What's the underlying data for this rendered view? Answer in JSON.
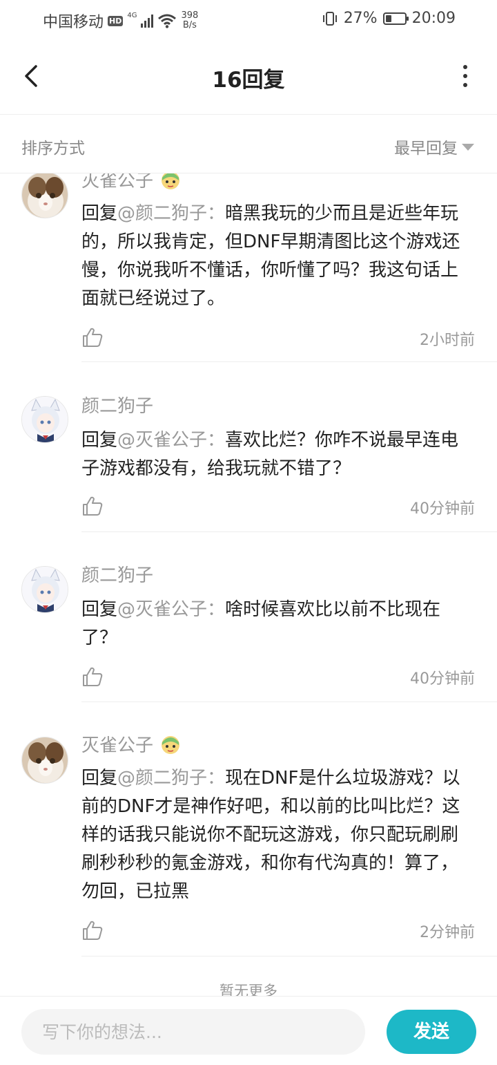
{
  "status_bar": {
    "carrier": "中国移动",
    "hd": "HD",
    "network": "4G",
    "speed_value": "398",
    "speed_unit": "B/s",
    "battery": "27%",
    "time": "20:09"
  },
  "header": {
    "title": "16回复"
  },
  "sort": {
    "label": "排序方式",
    "selected": "最早回复"
  },
  "replies": [
    {
      "username": "灭雀公子",
      "prefix": "回复",
      "mention": "@颜二狗子：",
      "text": "暗黑我玩的少而且是近些年玩的，所以我肯定，但DNF早期清图比这个游戏还慢，你说我听不懂话，你听懂了吗？我这句话上面就已经说过了。",
      "time": "2小时前",
      "avatar": "cat-avatar"
    },
    {
      "username": "颜二狗子",
      "prefix": "回复",
      "mention": "@灭雀公子：",
      "text": "喜欢比烂？你咋不说最早连电子游戏都没有，给我玩就不错了？",
      "time": "40分钟前",
      "avatar": "anime-girl-avatar"
    },
    {
      "username": "颜二狗子",
      "prefix": "回复",
      "mention": "@灭雀公子：",
      "text": "啥时候喜欢比以前不比现在了？",
      "time": "40分钟前",
      "avatar": "anime-girl-avatar"
    },
    {
      "username": "灭雀公子",
      "prefix": "回复",
      "mention": "@颜二狗子：",
      "text": "现在DNF是什么垃圾游戏？以前的DNF才是神作好吧，和以前的比叫比烂？这样的话我只能说你不配玩这游戏，你只配玩刷刷刷秒秒秒的氪金游戏，和你有代沟真的！算了，勿回，已拉黑",
      "time": "2分钟前",
      "avatar": "cat-avatar"
    }
  ],
  "footer": {
    "no_more": "暂无更多"
  },
  "input": {
    "placeholder": "写下你的想法...",
    "value": "",
    "send_label": "发送"
  },
  "colors": {
    "accent": "#1db8c7",
    "muted_text": "#999999",
    "body_text": "#222222",
    "divider": "#eeeeee"
  }
}
